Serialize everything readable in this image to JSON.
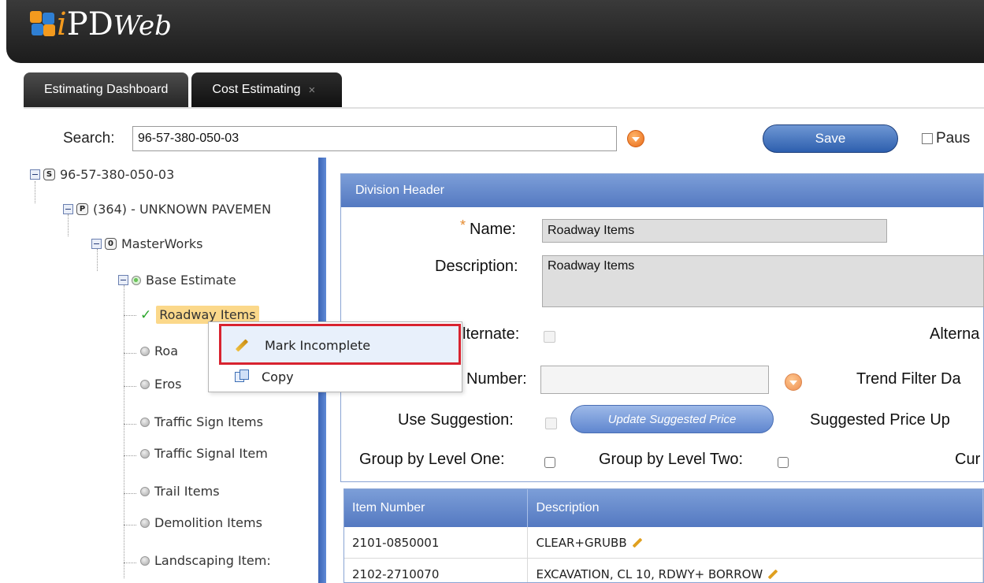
{
  "app": {
    "logo_i": "i",
    "logo_pd": "PD",
    "logo_web": "Web"
  },
  "tabs": [
    {
      "label": "Estimating Dashboard"
    },
    {
      "label": "Cost Estimating",
      "close": "×"
    }
  ],
  "search": {
    "label": "Search:",
    "value": "96-57-380-050-03"
  },
  "toolbar": {
    "save_label": "Save",
    "pause_label": "Paus"
  },
  "tree": {
    "root": {
      "badge": "S",
      "label": "96-57-380-050-03"
    },
    "project": {
      "badge": "P",
      "label": "(364) - UNKNOWN PAVEMEN"
    },
    "masterworks": {
      "badge": "0",
      "label": "MasterWorks"
    },
    "base": {
      "label": "Base Estimate"
    },
    "items": [
      {
        "label": "Roadway Items",
        "checked": true,
        "selected": true
      },
      {
        "label": "Roa"
      },
      {
        "label": "Eros"
      },
      {
        "label": "Traffic Sign Items"
      },
      {
        "label": "Traffic Signal Item"
      },
      {
        "label": "Trail Items"
      },
      {
        "label": "Demolition Items"
      },
      {
        "label": "Landscaping Item:"
      }
    ]
  },
  "context_menu": {
    "items": [
      {
        "label": "Mark Incomplete",
        "icon": "pencil-icon"
      },
      {
        "label": "Copy",
        "icon": "copy-icon"
      }
    ]
  },
  "division": {
    "header": "Division Header",
    "required_mark": "*",
    "name_label": "Name:",
    "name_value": "Roadway Items",
    "description_label": "Description:",
    "description_value": "Roadway Items",
    "alternate_label": "lternate:",
    "alternate_right_label": "Alterna",
    "number_label": "Number:",
    "number_value": "",
    "trend_filter_label": "Trend Filter Da",
    "use_suggestion_label": "Use Suggestion:",
    "update_price_label": "Update Suggested Price",
    "suggested_price_label": "Suggested Price Up",
    "group_one_label": "Group by Level One:",
    "group_two_label": "Group by Level Two:",
    "cur_label": "Cur"
  },
  "grid": {
    "columns": [
      "Item Number",
      "Description"
    ],
    "rows": [
      {
        "item": "2101-0850001",
        "desc": "CLEAR+GRUBB"
      },
      {
        "item": "2102-2710070",
        "desc": "EXCAVATION, CL 10, RDWY+ BORROW"
      }
    ]
  },
  "colors": {
    "accent": "#5479c1",
    "highlight": "#d8232f",
    "selected": "#fbd88a"
  }
}
